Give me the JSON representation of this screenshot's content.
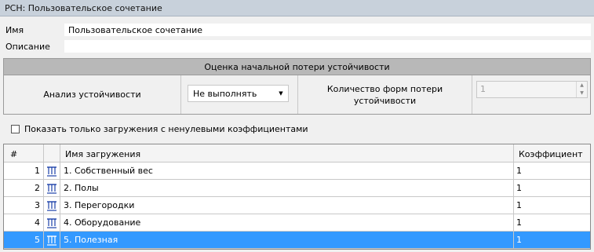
{
  "window": {
    "title": "РСН: Пользовательское сочетание"
  },
  "form": {
    "name_label": "Имя",
    "name_value": "Пользовательское сочетание",
    "description_label": "Описание",
    "description_value": ""
  },
  "stability": {
    "header": "Оценка начальной потери устойчивости",
    "analysis_label": "Анализ устойчивости",
    "analysis_value": "Не выполнять",
    "forms_label_line1": "Количество форм потери",
    "forms_label_line2": "устойчивости",
    "forms_value": "1"
  },
  "filter": {
    "label": "Показать только загружения с ненулевыми коэффициентами",
    "checked": false
  },
  "table": {
    "columns": {
      "num": "#",
      "name": "Имя загружения",
      "coef": "Коэффициент"
    },
    "rows": [
      {
        "num": "1",
        "name": "1. Собственный вес",
        "coef": "1",
        "icon": "load-icon"
      },
      {
        "num": "2",
        "name": "2. Полы",
        "coef": "1",
        "icon": "load-icon"
      },
      {
        "num": "3",
        "name": "3. Перегородки",
        "coef": "1",
        "icon": "load-icon"
      },
      {
        "num": "4",
        "name": "4. Оборудование",
        "coef": "1",
        "icon": "load-icon"
      },
      {
        "num": "5",
        "name": "5. Полезная",
        "coef": "1",
        "icon": "load-icon",
        "selected": true
      }
    ]
  },
  "colors": {
    "selection": "#3399ff",
    "header_band": "#b8b8b8",
    "titlebar": "#c8d1db",
    "icon": "#1a3fa8"
  }
}
